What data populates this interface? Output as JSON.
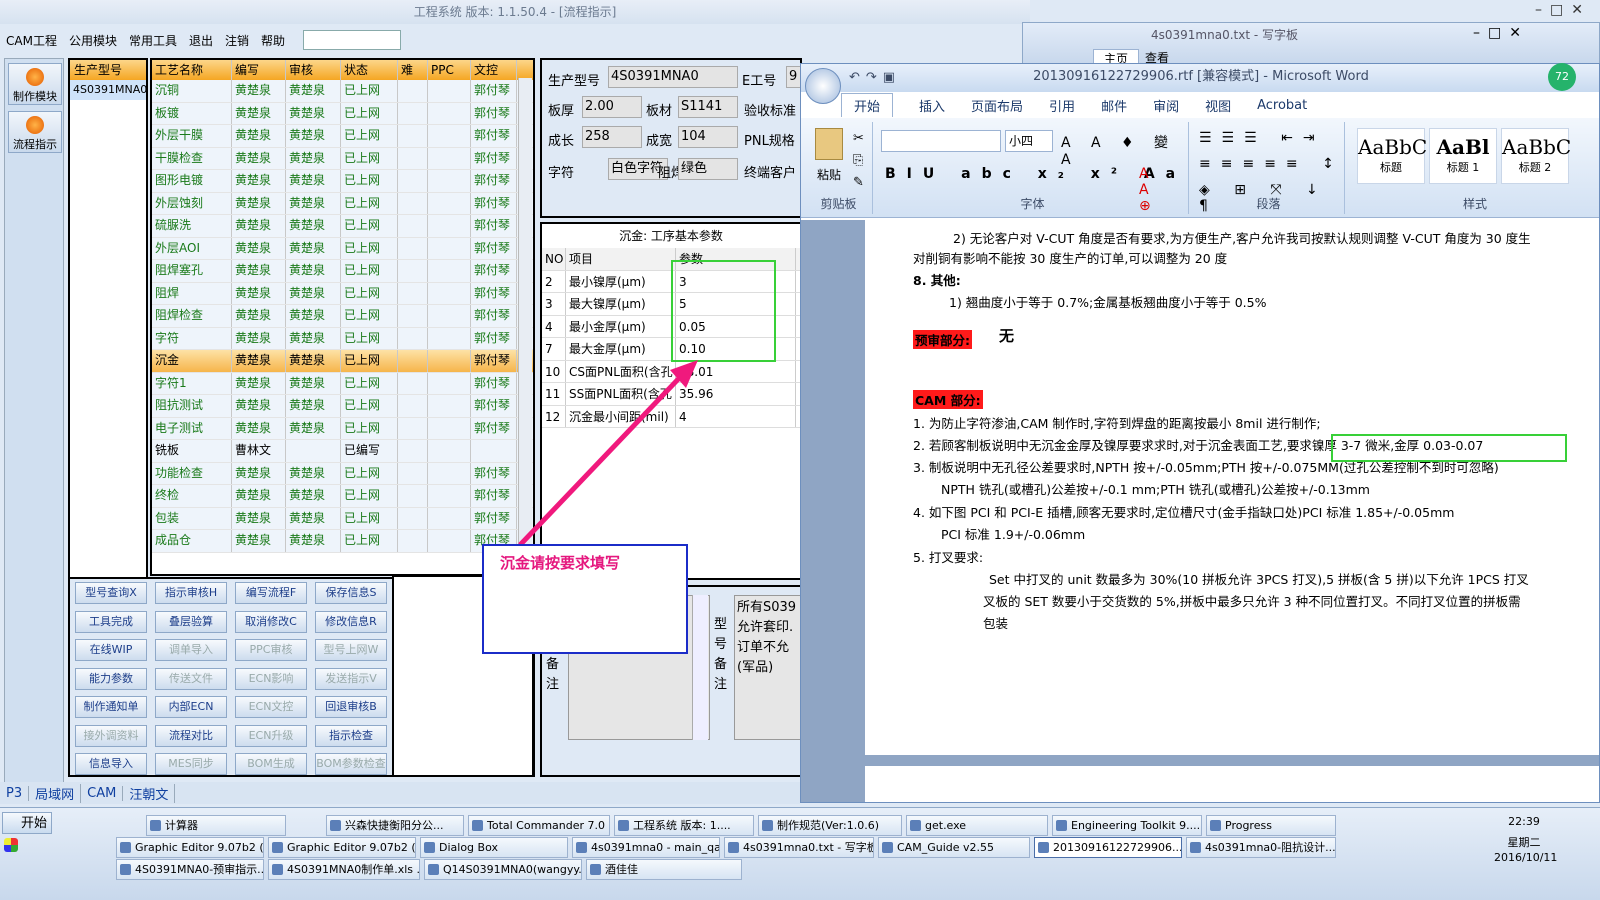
{
  "app": {
    "title": "工程系统  版本: 1.1.50.4 - [流程指示]",
    "menu": [
      "CAM工程",
      "公用模块",
      "常用工具",
      "退出",
      "注销",
      "帮助"
    ],
    "left_buttons": [
      "制作模块",
      "流程指示"
    ]
  },
  "model": {
    "header": "生产型号",
    "value": "4S0391MNA0"
  },
  "process": {
    "headers": [
      "工艺名称",
      "编写",
      "审核",
      "状态",
      "难",
      "PPC",
      "文控"
    ],
    "rows": [
      [
        "沉铜",
        "黄楚泉",
        "黄楚泉",
        "已上网",
        "",
        "",
        "郭付琴"
      ],
      [
        "板镀",
        "黄楚泉",
        "黄楚泉",
        "已上网",
        "",
        "",
        "郭付琴"
      ],
      [
        "外层干膜",
        "黄楚泉",
        "黄楚泉",
        "已上网",
        "",
        "",
        "郭付琴"
      ],
      [
        "干膜检查",
        "黄楚泉",
        "黄楚泉",
        "已上网",
        "",
        "",
        "郭付琴"
      ],
      [
        "图形电镀",
        "黄楚泉",
        "黄楚泉",
        "已上网",
        "",
        "",
        "郭付琴"
      ],
      [
        "外层蚀刻",
        "黄楚泉",
        "黄楚泉",
        "已上网",
        "",
        "",
        "郭付琴"
      ],
      [
        "硫脲洗",
        "黄楚泉",
        "黄楚泉",
        "已上网",
        "",
        "",
        "郭付琴"
      ],
      [
        "外层AOI",
        "黄楚泉",
        "黄楚泉",
        "已上网",
        "",
        "",
        "郭付琴"
      ],
      [
        "阻焊塞孔",
        "黄楚泉",
        "黄楚泉",
        "已上网",
        "",
        "",
        "郭付琴"
      ],
      [
        "阻焊",
        "黄楚泉",
        "黄楚泉",
        "已上网",
        "",
        "",
        "郭付琴"
      ],
      [
        "阻焊检查",
        "黄楚泉",
        "黄楚泉",
        "已上网",
        "",
        "",
        "郭付琴"
      ],
      [
        "字符",
        "黄楚泉",
        "黄楚泉",
        "已上网",
        "",
        "",
        "郭付琴"
      ],
      [
        "沉金",
        "黄楚泉",
        "黄楚泉",
        "已上网",
        "",
        "",
        "郭付琴"
      ],
      [
        "字符1",
        "黄楚泉",
        "黄楚泉",
        "已上网",
        "",
        "",
        "郭付琴"
      ],
      [
        "阻抗测试",
        "黄楚泉",
        "黄楚泉",
        "已上网",
        "",
        "",
        "郭付琴"
      ],
      [
        "电子测试",
        "黄楚泉",
        "黄楚泉",
        "已上网",
        "",
        "",
        "郭付琴"
      ],
      [
        "铣板",
        "曹林文",
        "",
        "已编写",
        "",
        "",
        ""
      ],
      [
        "功能检查",
        "黄楚泉",
        "黄楚泉",
        "已上网",
        "",
        "",
        "郭付琴"
      ],
      [
        "终检",
        "黄楚泉",
        "黄楚泉",
        "已上网",
        "",
        "",
        "郭付琴"
      ],
      [
        "包装",
        "黄楚泉",
        "黄楚泉",
        "已上网",
        "",
        "",
        "郭付琴"
      ],
      [
        "成品仓",
        "黄楚泉",
        "黄楚泉",
        "已上网",
        "",
        "",
        "郭付琴"
      ]
    ],
    "selected_index": 12
  },
  "actions": {
    "buttons": [
      [
        "型号查询X",
        "指示审核H",
        "编写流程F",
        "保存信息S"
      ],
      [
        "工具完成",
        "叠层验算",
        "取消修改C",
        "修改信息R"
      ],
      [
        "在线WIP",
        "调单导入",
        "PPC审核",
        "型号上网W"
      ],
      [
        "能力参数",
        "传送文件",
        "ECN影响",
        "发送指示V"
      ],
      [
        "制作通知单",
        "内部ECN",
        "ECN文控",
        "回退审核B"
      ],
      [
        "接外调资料",
        "流程对比",
        "ECN升级",
        "指示检查"
      ],
      [
        "信息导入",
        "MES同步",
        "BOM生成",
        "BOM参数检查"
      ]
    ],
    "disabled": [
      "调单导入",
      "PPC审核",
      "型号上网W",
      "传送文件",
      "ECN影响",
      "发送指示V",
      "ECN文控",
      "接外调资料",
      "ECN升级",
      "MES同步",
      "BOM生成",
      "BOM参数检查"
    ]
  },
  "bottom_tabs": [
    "P3",
    "局域网",
    "CAM",
    "汪朝文"
  ],
  "info": {
    "fields": [
      {
        "label": "生产型号",
        "value": "4S0391MNA0"
      },
      {
        "label": "E工号",
        "value": "9"
      },
      {
        "label": "板厚",
        "value": "2.00"
      },
      {
        "label": "板材",
        "value": "S1141"
      },
      {
        "label": "验收标准",
        "value": ""
      },
      {
        "label": "成长",
        "value": "258"
      },
      {
        "label": "成宽",
        "value": "104"
      },
      {
        "label": "PNL规格",
        "value": ""
      },
      {
        "label": "字符",
        "value": "白色字符"
      },
      {
        "label": "阻焊",
        "value": "绿色"
      },
      {
        "label": "终端客户",
        "value": ""
      }
    ]
  },
  "params": {
    "title": "沉金: 工序基本参数",
    "headers": [
      "NO",
      "项目",
      "参数"
    ],
    "rows": [
      [
        "2",
        "最小镍厚(μm)",
        "3"
      ],
      [
        "3",
        "最大镍厚(μm)",
        "5"
      ],
      [
        "4",
        "最小金厚(μm)",
        "0.05"
      ],
      [
        "7",
        "最大金厚(μm)",
        "0.10"
      ],
      [
        "10",
        "CS面PNL面积(含孔",
        "28.01"
      ],
      [
        "11",
        "SS面PNL面积(含孔",
        "35.96"
      ],
      [
        "12",
        "沉金最小间距(mil)",
        "4"
      ]
    ]
  },
  "remark": {
    "label": "备注",
    "label2": "型号备注",
    "text": "所有S039 允许套印. 订单不允 (军品)"
  },
  "annotation": {
    "text": "沉金请按要求填写",
    "arrow_color": "#f0197d",
    "box_color": "#38d038"
  },
  "wordpad": {
    "title": "4s0391mna0.txt - 写字板",
    "tabs": [
      "主页",
      "查看"
    ]
  },
  "word": {
    "title": "20130916122729906.rtf [兼容模式] - Microsoft Word",
    "tabs": [
      "开始",
      "插入",
      "页面布局",
      "引用",
      "邮件",
      "审阅",
      "视图",
      "Acrobat"
    ],
    "groups": [
      "剪贴板",
      "字体",
      "段落",
      "样式"
    ],
    "paste": "粘贴",
    "font_size": "小四",
    "styles": [
      {
        "sample": "AaBbC",
        "name": "标题"
      },
      {
        "sample": "AaBl",
        "name": "标题 1"
      },
      {
        "sample": "AaBbC",
        "name": "标题 2"
      }
    ],
    "doc_lines": [
      "2) 无论客户对 V-CUT 角度是否有要求,为方便生产,客户允许我司按默认规则调整 V-CUT 角度为 30 度生",
      "对削铜有影响不能按 30 度生产的订单,可以调整为 20 度",
      "8.  其他:",
      "1) 翘曲度小于等于 0.7%;金属基板翘曲度小于等于 0.5%",
      "预审部分:",
      "无",
      "CAM 部分:",
      "1.   为防止字符渗油,CAM 制作时,字符到焊盘的距离按最小 8mil 进行制作;",
      "2.   若顾客制板说明中无沉金金厚及镍厚要求求时,对于沉金表面工艺,要求镍厚 3-7 微米,金厚 0.03-0.07",
      "3.   制板说明中无孔径公差要求时,NPTH 按+/-0.05mm;PTH 按+/-0.075MM(过孔公差控制不到时可忽略)",
      "NPTH 铣孔(或槽孔)公差按+/-0.1 mm;PTH 铣孔(或槽孔)公差按+/-0.13mm",
      "4.   如下图 PCI 和 PCI-E 插槽,顾客无要求时,定位槽尺寸(金手指缺口处)PCI 标准 1.85+/-0.05mm",
      "PCI 标准 1.9+/-0.06mm",
      "5. 打叉要求:",
      "Set 中打叉的 unit 数最多为 30%(10 拼板允许 3PCS 打叉),5 拼板(含 5 拼)以下允许 1PCS 打叉",
      "叉板的 SET 数要小于交货数的 5%,拼板中最多只允许 3 种不同位置打叉。不同打叉位置的拼板需",
      "包装"
    ]
  },
  "taskbar": {
    "start": "开始",
    "row1": [
      "计算器",
      "兴森快捷衡阳分公...",
      "Total Commander 7.0 ...",
      "工程系统  版本: 1....",
      "制作规范(Ver:1.0.6)",
      "get.exe",
      "Engineering Toolkit 9....",
      "Progress"
    ],
    "row2": [
      "Graphic Editor 9.07b2 (...",
      "Graphic Editor 9.07b2 (...",
      "Dialog Box",
      "4s0391mna0 - main_qa",
      "4s0391mna0.txt - 写字板",
      "CAM_Guide v2.55",
      "20130916122729906...",
      "4s0391mna0-阻抗设计..."
    ],
    "row3": [
      "4S0391MNA0-预审指示...",
      "4S0391MNA0制作单.xls ...",
      "Q14S0391MNA0(wangyy...",
      "酒佳佳"
    ],
    "time": "22:39",
    "weekday": "星期二",
    "date": "2016/10/11"
  }
}
